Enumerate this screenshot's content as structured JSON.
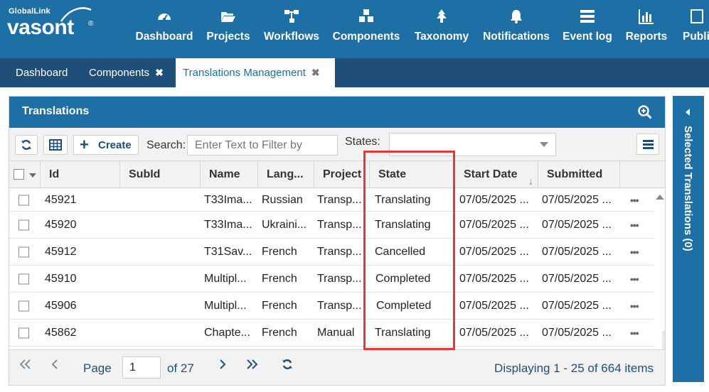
{
  "app": {
    "logo_small": "GlobalLink",
    "logo_big": "vasont",
    "logo_reg": "®"
  },
  "nav": [
    {
      "label": "Dashboard",
      "icon": "dashboard-icon"
    },
    {
      "label": "Projects",
      "icon": "folder-open-icon"
    },
    {
      "label": "Workflows",
      "icon": "sitemap-icon"
    },
    {
      "label": "Components",
      "icon": "cubes-icon"
    },
    {
      "label": "Taxonomy",
      "icon": "tree-icon"
    },
    {
      "label": "Notifications",
      "icon": "bell-icon"
    },
    {
      "label": "Event log",
      "icon": "list-icon"
    },
    {
      "label": "Reports",
      "icon": "bar-chart-icon"
    },
    {
      "label": "Publis",
      "icon": "publish-icon"
    }
  ],
  "tabs": [
    {
      "label": "Dashboard",
      "closable": false
    },
    {
      "label": "Components",
      "close": "✖"
    },
    {
      "label": "Translations Management",
      "close": "✖",
      "active": true
    }
  ],
  "panel": {
    "title": "Translations",
    "create_label": "Create",
    "search_label": "Search:",
    "search_placeholder": "Enter Text to Filter by",
    "states_label": "States:",
    "states_value": ""
  },
  "columns": [
    "Id",
    "SubId",
    "Name",
    "Lang...",
    "Project",
    "State",
    "Start Date",
    "Submitted"
  ],
  "sort_indicator": "↓",
  "rows": [
    {
      "id": "45921",
      "subid": "",
      "name": "T33Ima...",
      "lang": "Russian",
      "project": "Transp...",
      "state": "Translating",
      "start": "07/05/2025 ...",
      "submitted": "07/05/2025 ..."
    },
    {
      "id": "45920",
      "subid": "",
      "name": "T33Ima...",
      "lang": "Ukraini...",
      "project": "Transp...",
      "state": "Translating",
      "start": "07/05/2025 ...",
      "submitted": "07/05/2025 ..."
    },
    {
      "id": "45912",
      "subid": "",
      "name": "T31Sav...",
      "lang": "French",
      "project": "Transp...",
      "state": "Cancelled",
      "start": "07/05/2025 ...",
      "submitted": "07/05/2025 ..."
    },
    {
      "id": "45910",
      "subid": "",
      "name": "Multipl...",
      "lang": "French",
      "project": "Transp...",
      "state": "Completed",
      "start": "07/05/2025 ...",
      "submitted": "07/05/2025 ..."
    },
    {
      "id": "45906",
      "subid": "",
      "name": "Multipl...",
      "lang": "French",
      "project": "Transp...",
      "state": "Completed",
      "start": "07/05/2025 ...",
      "submitted": "07/05/2025 ..."
    },
    {
      "id": "45862",
      "subid": "",
      "name": "Chapte...",
      "lang": "French",
      "project": "Manual",
      "state": "Translating",
      "start": "07/05/2025 ...",
      "submitted": "07/05/2025 ..."
    }
  ],
  "row_menu": "•••",
  "pager": {
    "page_label": "Page",
    "page_value": "1",
    "of_label": "of 27",
    "display_text": "Displaying 1 - 25 of 664 items"
  },
  "side_panel": {
    "label": "Selected Translations (0)"
  },
  "colors": {
    "primary": "#1d6fa5",
    "dark": "#1f4e79",
    "highlight": "#e53935"
  }
}
